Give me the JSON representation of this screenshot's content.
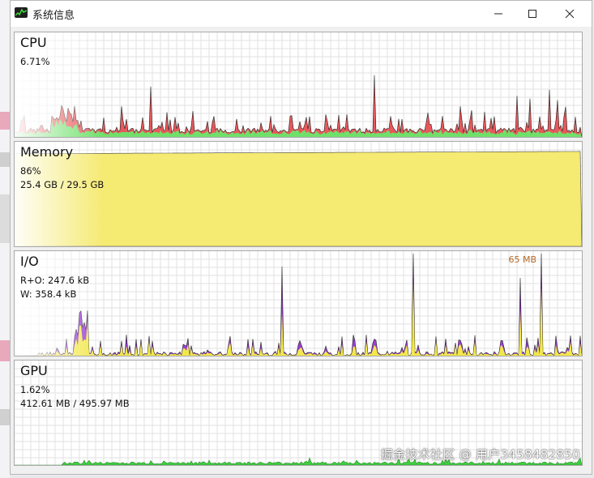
{
  "window": {
    "title": "系统信息",
    "icon": "chart-app-icon",
    "buttons": [
      "minimize-icon",
      "maximize-icon",
      "close-icon"
    ]
  },
  "panels": {
    "cpu": {
      "title": "CPU",
      "line1": "6.71%",
      "series_colors": [
        "#e8585c",
        "#6fe06a"
      ]
    },
    "memory": {
      "title": "Memory",
      "line1": "86%",
      "line2": "25.4 GB / 29.5 GB",
      "fill_color": "#f5ea72",
      "level_percent": 86
    },
    "io": {
      "title": "I/O",
      "line1": "R+O: 247.6 kB",
      "line2": "W: 358.4 kB",
      "peak_label": "65 MB",
      "series_colors": [
        "#9a3fd6",
        "#f2e84a"
      ]
    },
    "gpu": {
      "title": "GPU",
      "line1": "1.62%",
      "line2": "412.61 MB / 495.97 MB",
      "series_colors": [
        "#3fcf3f"
      ]
    }
  },
  "watermark": "掘金技术社区 @ 用户3458482850"
}
